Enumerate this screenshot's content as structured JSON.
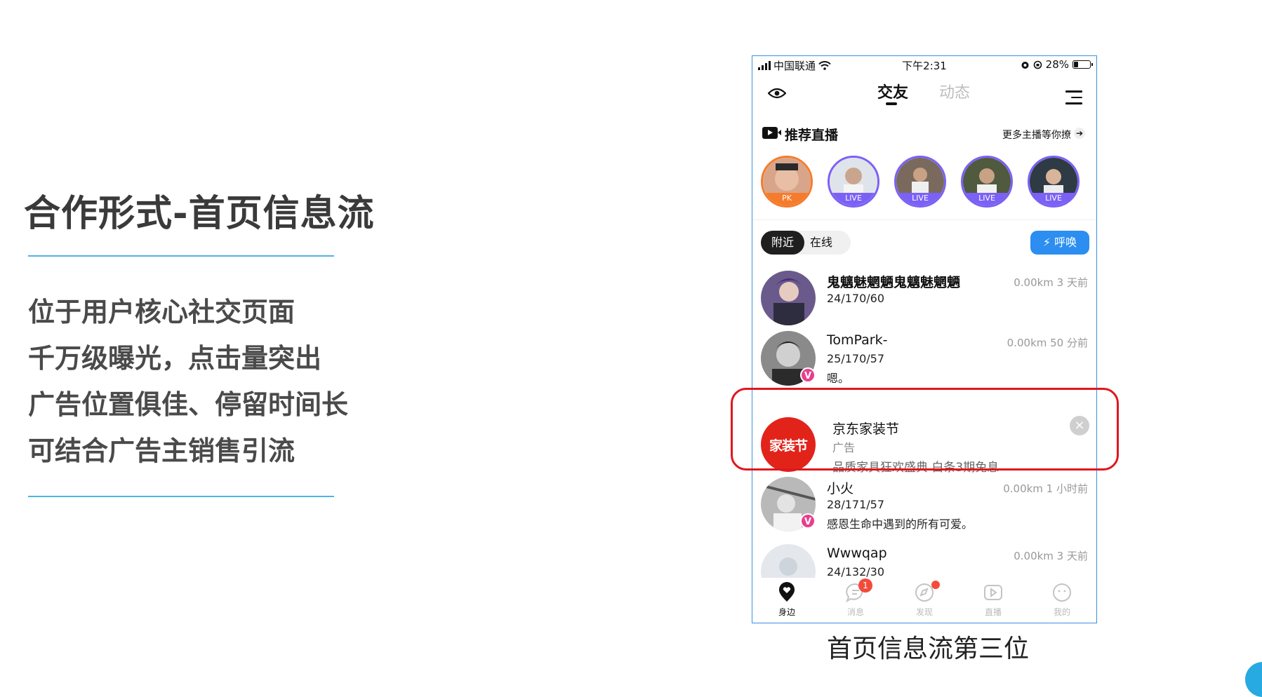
{
  "slide": {
    "title": "合作形式-首页信息流",
    "bullets": [
      "位于用户核心社交页面",
      "千万级曝光，点击量突出",
      "广告位置俱佳、停留时间长",
      "可结合广告主销售引流"
    ],
    "caption": "首页信息流第三位"
  },
  "status_bar": {
    "carrier": "中国联通",
    "time": "下午2:31",
    "battery": "28%",
    "battery_level": 0.28
  },
  "nav": {
    "tab_active": "交友",
    "tab_inactive": "动态"
  },
  "live": {
    "title": "推荐直播",
    "more": "更多主播等你撩",
    "badges": [
      "PK",
      "LIVE",
      "LIVE",
      "LIVE",
      "LIVE"
    ]
  },
  "filter": {
    "nearby": "附近",
    "online": "在线",
    "call": "呼唤"
  },
  "feed": [
    {
      "name": "鬼魑魅魍魉鬼魑魅魍魉",
      "meta": "0.00km 3 天前",
      "stats": "24/170/60",
      "msg": "",
      "verified": false
    },
    {
      "name": "TomPark-",
      "meta": "0.00km 50 分前",
      "stats": "25/170/57",
      "msg": "嗯。",
      "verified": true
    },
    {
      "name": "小火",
      "meta": "0.00km 1 小时前",
      "stats": "28/171/57",
      "msg": "感恩生命中遇到的所有可爱。",
      "verified": true
    },
    {
      "name": "Wwwqap",
      "meta": "0.00km 3 天前",
      "stats": "24/132/30",
      "msg": "",
      "verified": false
    }
  ],
  "ad": {
    "logo_text": "家装节",
    "name": "京东家装节",
    "tag": "广告",
    "desc": "品质家具狂欢盛典 白条3期免息",
    "close": "×"
  },
  "tabbar": [
    {
      "label": "身边",
      "icon": "location-pin-icon"
    },
    {
      "label": "消息",
      "icon": "message-icon",
      "badge": "1"
    },
    {
      "label": "发现",
      "icon": "compass-icon"
    },
    {
      "label": "直播",
      "icon": "live-video-icon"
    },
    {
      "label": "我的",
      "icon": "profile-face-icon"
    }
  ],
  "colors": {
    "accent_blue": "#2b8ef0",
    "live_purple": "#7b61f5",
    "pk_orange": "#f57c2c",
    "highlight_red": "#e0171e",
    "jd_red": "#e2231a",
    "rule_blue": "#4fb3e8"
  }
}
